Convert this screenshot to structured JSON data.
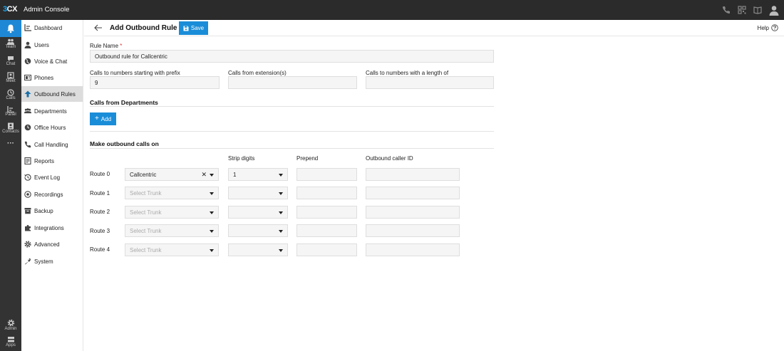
{
  "app": {
    "brand_prefix": "3",
    "brand_suffix": "CX",
    "title": "Admin Console"
  },
  "rail": [
    {
      "label": "",
      "icon": "bell-icon"
    },
    {
      "label": "Team",
      "icon": "team-icon"
    },
    {
      "label": "Chat",
      "icon": "chat-icon"
    },
    {
      "label": "Meet",
      "icon": "meet-icon"
    },
    {
      "label": "Calls",
      "icon": "calls-icon"
    },
    {
      "label": "Panel",
      "icon": "panel-icon"
    },
    {
      "label": "Contacts",
      "icon": "contacts-icon"
    },
    {
      "label": "···",
      "icon": "more-icon"
    },
    {
      "label": "Admin",
      "icon": "gear-icon"
    },
    {
      "label": "Apps",
      "icon": "apps-icon"
    }
  ],
  "nav": [
    {
      "label": "Dashboard",
      "icon": "dashboard-icon"
    },
    {
      "label": "Users",
      "icon": "user-icon"
    },
    {
      "label": "Voice & Chat",
      "icon": "globe-icon"
    },
    {
      "label": "Phones",
      "icon": "phone-device-icon"
    },
    {
      "label": "Outbound Rules",
      "icon": "upload-arrow-icon",
      "active": true
    },
    {
      "label": "Departments",
      "icon": "departments-icon"
    },
    {
      "label": "Office Hours",
      "icon": "clock-icon"
    },
    {
      "label": "Call Handling",
      "icon": "phone-icon"
    },
    {
      "label": "Reports",
      "icon": "reports-icon"
    },
    {
      "label": "Event Log",
      "icon": "history-icon"
    },
    {
      "label": "Recordings",
      "icon": "record-icon"
    },
    {
      "label": "Backup",
      "icon": "archive-icon"
    },
    {
      "label": "Integrations",
      "icon": "puzzle-icon"
    },
    {
      "label": "Advanced",
      "icon": "cog-icon"
    },
    {
      "label": "System",
      "icon": "wrench-icon"
    }
  ],
  "header": {
    "title": "Add Outbound Rule",
    "save_label": "Save",
    "help_label": "Help"
  },
  "form": {
    "rule_name_label": "Rule Name",
    "rule_name_required": "*",
    "rule_name_value": "Outbound rule for Callcentric",
    "prefix_label": "Calls to numbers starting with prefix",
    "prefix_value": "9",
    "from_ext_label": "Calls from extension(s)",
    "from_ext_value": "",
    "length_label": "Calls to numbers with a length of",
    "length_value": "",
    "departments_heading": "Calls from Departments",
    "add_label": "Add",
    "outbound_heading": "Make outbound calls on",
    "col_strip": "Strip digits",
    "col_prepend": "Prepend",
    "col_callerid": "Outbound caller ID",
    "trunk_placeholder": "Select Trunk",
    "routes": [
      {
        "label": "Route 0",
        "trunk": "Callcentric",
        "strip": "1",
        "prepend": "",
        "caller_id": ""
      },
      {
        "label": "Route 1",
        "trunk": "",
        "strip": "",
        "prepend": "",
        "caller_id": ""
      },
      {
        "label": "Route 2",
        "trunk": "",
        "strip": "",
        "prepend": "",
        "caller_id": ""
      },
      {
        "label": "Route 3",
        "trunk": "",
        "strip": "",
        "prepend": "",
        "caller_id": ""
      },
      {
        "label": "Route 4",
        "trunk": "",
        "strip": "",
        "prepend": "",
        "caller_id": ""
      }
    ]
  },
  "colors": {
    "accent": "#1a8dd8",
    "topbar": "#2b2b2b",
    "rail": "#333333",
    "active_nav": "#dcdcdc"
  }
}
